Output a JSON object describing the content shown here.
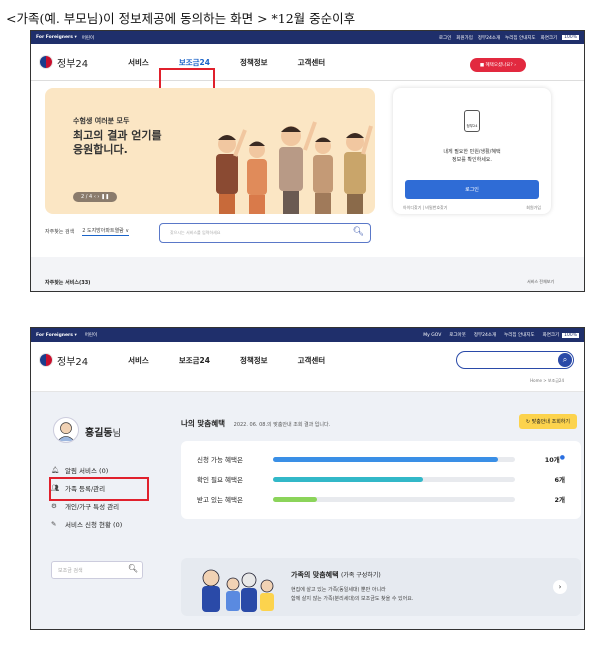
{
  "caption": "<가족(예. 부모님)이 정보제공에 동의하는 화면 >    *12월 중순이후",
  "shot1": {
    "topbar": {
      "foreigners": "For Foreigners ▾",
      "lang": "어린이",
      "links": [
        "로그인",
        "회원가입",
        "정부24소개",
        "누리집 안내지도",
        "화면크기"
      ],
      "size_value": "100%"
    },
    "logo_text": "정부24",
    "menu": [
      "서비스",
      "보조금24",
      "정책정보",
      "고객센터"
    ],
    "recommend_button": "■ 혜택오셨나요? ›",
    "banner": {
      "small": "수험생 여러분 모두",
      "big1": "최고의 결과 얻기를",
      "big2": "응원합니다.",
      "pager": "2 / 4  ‹  ›  ❚❚"
    },
    "login_card": {
      "icon_label": "정부24",
      "need1": "내게 필요한 민원/생활/혜택",
      "need2": "정보를 확인하세요.",
      "login_button": "로그인",
      "link_left": "아이디찾기 | 비밀번호찾기",
      "link_right": "회원가입"
    },
    "search": {
      "label": "자주찾는 검색",
      "select": "2 도지방아파트열람 ∨",
      "placeholder": "찾으시는 서비스를 입력하세요"
    },
    "footer": {
      "left": "자주찾는 서비스(33)",
      "right": "서비스 전체보기"
    }
  },
  "shot2": {
    "topbar": {
      "foreigners": "For Foreigners ▾",
      "lang": "어린이",
      "links": [
        "My GOV",
        "로그아웃",
        "정부24소개",
        "누리집 안내지도",
        "화면크기"
      ],
      "size_value": "100%"
    },
    "logo_text": "정부24",
    "menu": [
      "서비스",
      "보조금24",
      "정책정보",
      "고객센터"
    ],
    "breadcrumb": "Home > 보조금24",
    "user": {
      "name": "홍길동",
      "suffix": "님"
    },
    "side_menu": [
      "알림 서비스 (0)",
      "가족 등록/관리",
      "개인/가구 특성 관리",
      "서비스 신청 현황 (0)"
    ],
    "side_search_placeholder": "보조금 검색",
    "benefits": {
      "title": "나의 맞춤혜택",
      "subtitle": "2022. 06. 08.의 맞춤안내 조회 결과 입니다.",
      "refresh_button": "맞춤안내 조회하기",
      "rows": [
        {
          "label": "신청 가능 혜택은",
          "count": "10개",
          "fill": 0.93,
          "color": "#3a8fe6"
        },
        {
          "label": "확인 필요 혜택은",
          "count": "6개",
          "fill": 0.62,
          "color": "#32b8c8"
        },
        {
          "label": "받고 있는 혜택은",
          "count": "2개",
          "fill": 0.18,
          "color": "#8bd45a"
        }
      ]
    },
    "family": {
      "title": "가족의 맞춤혜택",
      "subtitle": "(가족 구성하기)",
      "desc1": "현집에 살고 있는 가족(동일세대) 뿐만 아니라",
      "desc2": "함께 살지 않는 가족(분리세대)의 보조금도 찾을 수 있어요."
    }
  }
}
